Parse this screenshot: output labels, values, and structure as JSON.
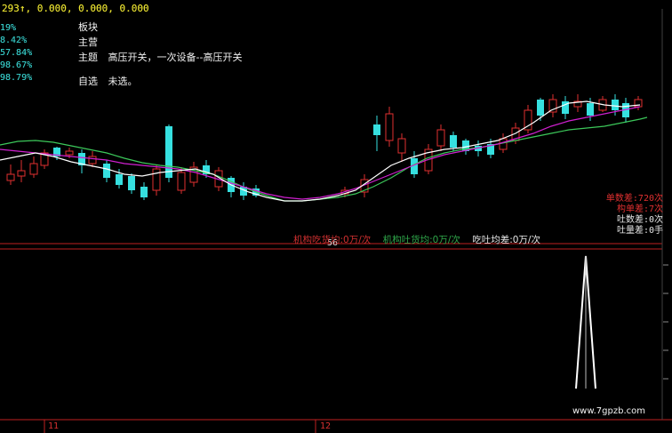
{
  "topbar": {
    "text": "293↑, 0.000, 0.000, 0.000"
  },
  "left_percentages": [
    "19%",
    "8.42%",
    "57.84%",
    "98.67%",
    "98.79%"
  ],
  "info": {
    "rows": [
      {
        "label": "板块",
        "value": ""
      },
      {
        "label": "主营",
        "value": ""
      },
      {
        "label": "主题",
        "value": "高压开关，一次设备--高压开关"
      }
    ],
    "watchlist": {
      "label": "自选",
      "value": "未选。"
    }
  },
  "stats": {
    "lines": [
      {
        "text": "单数差:720次",
        "color": "#e03030"
      },
      {
        "text": "构单差:7次",
        "color": "#e03030"
      },
      {
        "text": "吐数差:0次",
        "color": "#e6e6e6"
      },
      {
        "text": "吐量差:0手",
        "color": "#e6e6e6"
      },
      {
        "text": "吃吐均差:0万/次",
        "color": "#e6e6e6"
      }
    ]
  },
  "lower_labels": [
    {
      "text": "机构吃货均:0万/次",
      "color": "#d03030"
    },
    {
      "text": "机构吐货均:0万/次",
      "color": "#2fa84a"
    }
  ],
  "cursor_readout": "56",
  "bottom_axis": [
    "11",
    "12"
  ],
  "watermark": "www.7gpzb.com",
  "colors": {
    "up": "#e03030",
    "down": "#36e0e0",
    "ma_white": "#ffffff",
    "ma_magenta": "#d020d0",
    "ma_green": "#3cc85a",
    "peak": "#ffffff"
  }
}
